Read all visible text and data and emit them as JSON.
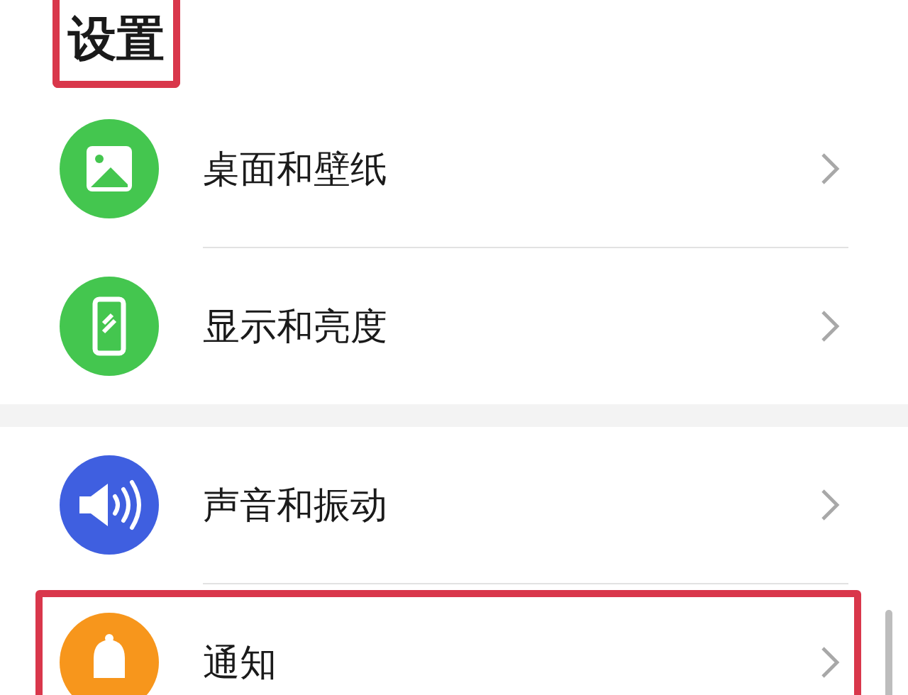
{
  "title": {
    "text": "设置",
    "highlighted": true
  },
  "groups": [
    {
      "items": [
        {
          "label": "桌面和壁纸",
          "color": "#44c64f",
          "highlighted": false
        },
        {
          "label": "显示和亮度",
          "color": "#44c64f",
          "highlighted": false
        }
      ]
    },
    {
      "items": [
        {
          "label": "声音和振动",
          "color": "#3f5fe0",
          "highlighted": false
        },
        {
          "label": "通知",
          "color": "#f7961c",
          "highlighted": true
        }
      ]
    }
  ]
}
